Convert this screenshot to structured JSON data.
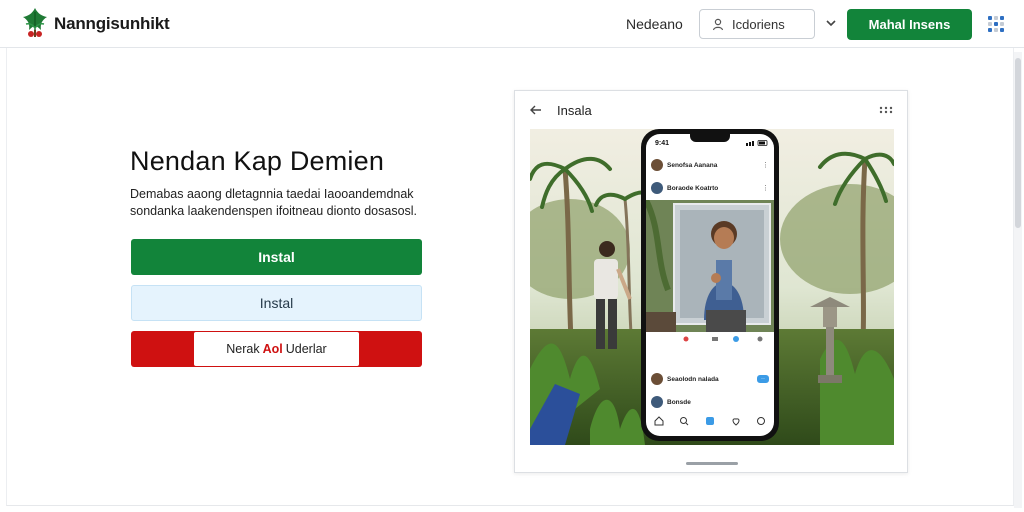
{
  "header": {
    "brand": "Nanngisunhikt",
    "nav_link": "Nedeano",
    "select_label": "Icdoriens",
    "cta_label": "Mahal Insens"
  },
  "hero": {
    "title": "Nendan Kap Demien",
    "description": "Demabas aaong dletagnnia taedai Iaooandemdnak sondanka laakendenspen ifoitneau dionto dosasosl.",
    "primary_button": "Instal",
    "secondary_button": "Instal",
    "danger_button_pre": "Nerak",
    "danger_button_hl": "Aol",
    "danger_button_post": "Uderlar"
  },
  "preview": {
    "title": "Insala",
    "phone": {
      "status_time": "9:41",
      "rows": [
        {
          "text": "Senofsa Aanana"
        },
        {
          "text": "Boraode Koatrto"
        },
        {
          "text": "Seaolodn nalada"
        },
        {
          "text": "Bonsde"
        }
      ]
    }
  },
  "colors": {
    "brand_green": "#12843a",
    "danger_red": "#cf1111",
    "light_blue": "#e5f3fd"
  }
}
